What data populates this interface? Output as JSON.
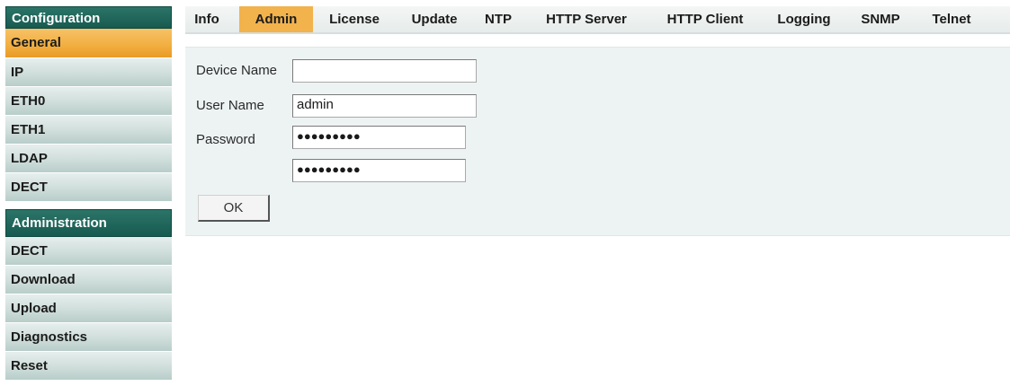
{
  "sidebar": {
    "configuration_header": "Configuration",
    "configuration_items": [
      {
        "label": "General",
        "active": true
      },
      {
        "label": "IP"
      },
      {
        "label": "ETH0"
      },
      {
        "label": "ETH1"
      },
      {
        "label": "LDAP"
      },
      {
        "label": "DECT"
      }
    ],
    "administration_header": "Administration",
    "administration_items": [
      {
        "label": "DECT"
      },
      {
        "label": "Download"
      },
      {
        "label": "Upload"
      },
      {
        "label": "Diagnostics"
      },
      {
        "label": "Reset"
      }
    ]
  },
  "tabs": [
    {
      "label": "Info"
    },
    {
      "label": "Admin",
      "active": true
    },
    {
      "label": "License"
    },
    {
      "label": "Update"
    },
    {
      "label": "NTP"
    },
    {
      "label": "HTTP Server"
    },
    {
      "label": "HTTP Client"
    },
    {
      "label": "Logging"
    },
    {
      "label": "SNMP"
    },
    {
      "label": "Telnet"
    }
  ],
  "form": {
    "device_name_label": "Device Name",
    "device_name_value": "",
    "user_name_label": "User Name",
    "user_name_value": "admin",
    "password_label": "Password",
    "password_mask": "●●●●●●●●●",
    "password_confirm_mask": "●●●●●●●●●",
    "ok_label": "OK"
  },
  "colors": {
    "header_teal": "#175a50",
    "active_orange": "#f1ae3f",
    "item_gray_green": "#cfdedb",
    "panel_bg": "#edf3f3"
  }
}
